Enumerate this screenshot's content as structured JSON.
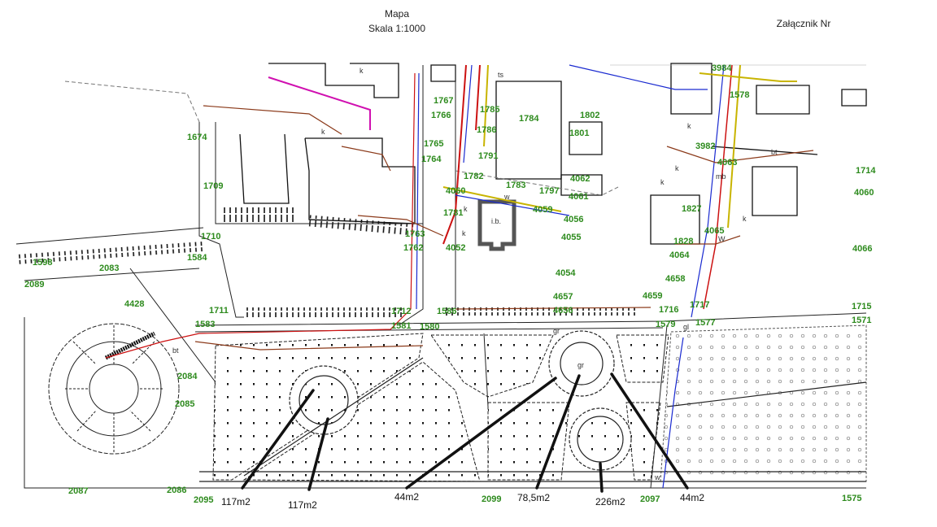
{
  "header": {
    "title": "Mapa",
    "scale": "Skala 1:1000",
    "attachment": "Załącznik Nr"
  },
  "map": {
    "parcel_color": "#2e8b1e",
    "parcels": [
      "1674",
      "1709",
      "1710",
      "1584",
      "1598",
      "2089",
      "2083",
      "4428",
      "1711",
      "1583",
      "2084",
      "2085",
      "2087",
      "2086",
      "2095",
      "1767",
      "1766",
      "1765",
      "1764",
      "1785",
      "1786",
      "1784",
      "1791",
      "1802",
      "1801",
      "1782",
      "1783",
      "4060",
      "1781",
      "1763",
      "1762",
      "4052",
      "1797",
      "4059",
      "4062",
      "4061",
      "4056",
      "4055",
      "4054",
      "4657",
      "1712",
      "1581",
      "1580",
      "4656",
      "4659",
      "1716",
      "1579",
      "1717",
      "1577",
      "4658",
      "4064",
      "1828",
      "4065",
      "1827",
      "4063",
      "3984",
      "3982",
      "1575",
      "2099",
      "2097",
      "1714",
      "4060",
      "4066",
      "1715",
      "1571",
      "1586",
      "1578"
    ],
    "building_label": "i.b.",
    "symbols": [
      "k",
      "ts",
      "w",
      "gr",
      "bt",
      "mb",
      "gl",
      "W"
    ],
    "areas": [
      "117m2",
      "117m2",
      "44m2",
      "78,5m2",
      "226m2",
      "44m2"
    ]
  }
}
